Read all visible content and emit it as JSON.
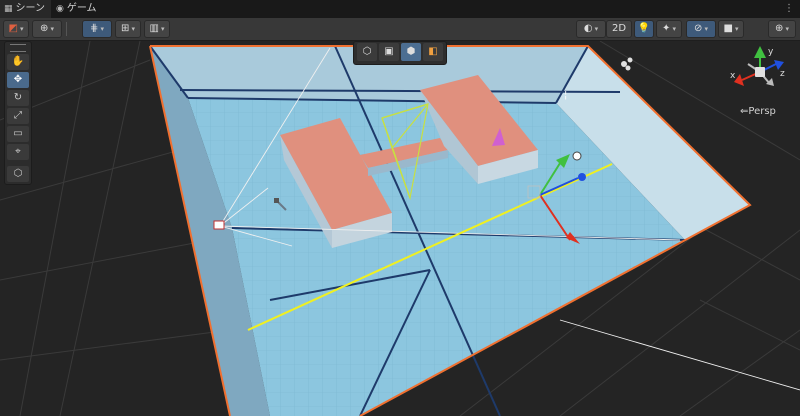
{
  "tabs": [
    {
      "label": "シーン",
      "icon": "grid-icon",
      "active": true
    },
    {
      "label": "ゲーム",
      "icon": "gamepad-icon",
      "active": false
    }
  ],
  "toolbar": {
    "draw_mode_icon": "shading-icon",
    "global_icon": "globe-icon",
    "grid_snap_icon": "grid-snap-icon",
    "increment_snap_icon": "increment-snap-icon",
    "audio_icon": "audio-icon",
    "lighting_icon": "lighting-icon",
    "mode_2d_label": "2D",
    "light_icon": "light-bulb-icon",
    "effects_icon": "effects-icon",
    "visibility_icon": "visibility-icon",
    "camera_icon": "camera-icon",
    "gizmos_icon": "gizmos-icon"
  },
  "tools": [
    {
      "name": "view-tool",
      "glyph": "✋",
      "active": false
    },
    {
      "name": "move-tool",
      "glyph": "✥",
      "active": true
    },
    {
      "name": "rotate-tool",
      "glyph": "↻",
      "active": false
    },
    {
      "name": "scale-tool",
      "glyph": "⤢",
      "active": false
    },
    {
      "name": "rect-tool",
      "glyph": "▭",
      "active": false
    },
    {
      "name": "transform-tool",
      "glyph": "⌖",
      "active": false
    },
    {
      "name": "custom-tool",
      "glyph": "⬡",
      "active": false
    }
  ],
  "overlay_tools": [
    "⬡",
    "▣",
    "⬢",
    "◧"
  ],
  "gizmo": {
    "label": "Persp",
    "axis_x": "x",
    "axis_y": "y",
    "axis_z": "z"
  },
  "colors": {
    "grid_floor": "#8fc8e0",
    "wall": "#b8d6e4",
    "box": "#e09080",
    "selection": "#f07030",
    "axis_x": "#e03020",
    "axis_y": "#40c040",
    "axis_z": "#2050e0",
    "yellow_line": "#f0f020"
  }
}
